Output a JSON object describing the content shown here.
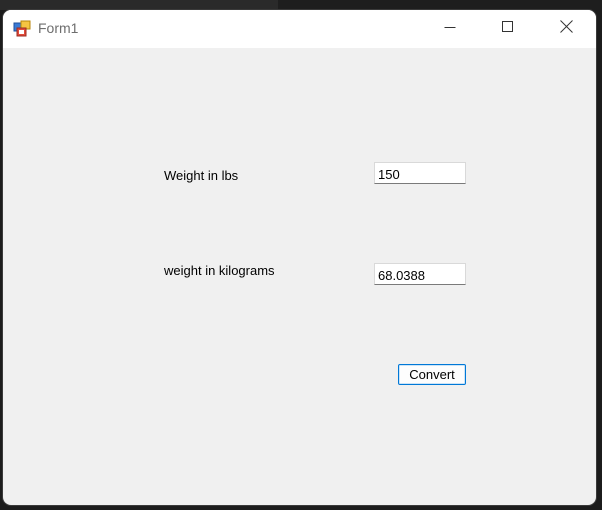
{
  "window": {
    "title": "Form1",
    "icon": "winforms-app-icon",
    "controls": {
      "minimize_icon": "minimize-icon",
      "maximize_icon": "maximize-icon",
      "close_icon": "close-icon"
    }
  },
  "form": {
    "weight_lbs_label": "Weight in lbs",
    "weight_lbs_value": "150",
    "weight_kg_label": "weight in kilograms",
    "weight_kg_value": "68.0388",
    "convert_button_label": "Convert"
  },
  "colors": {
    "form_background": "#f0f0f0",
    "titlebar_background": "#ffffff",
    "button_focus_border": "#0078d7"
  }
}
